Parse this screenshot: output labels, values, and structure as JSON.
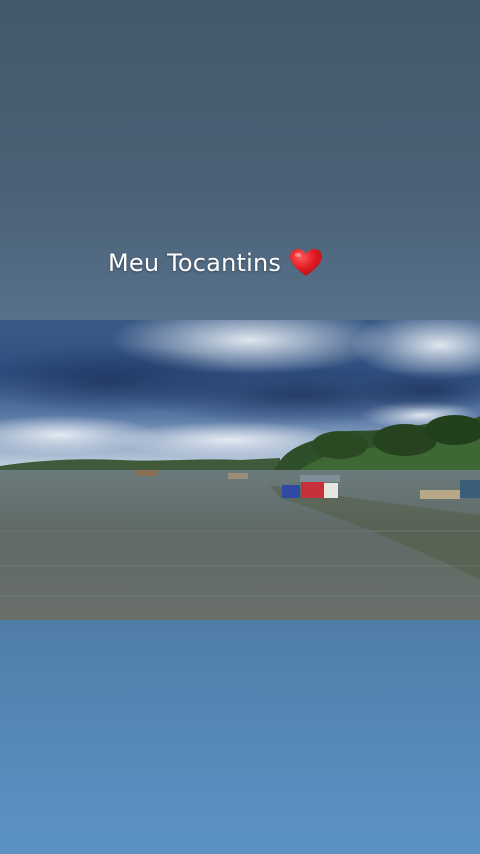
{
  "story": {
    "caption_text": "Meu Tocantins",
    "caption_emoji": "heart-icon",
    "background_top_color": "#44586a",
    "background_bottom_color": "#5b90c2",
    "heart_color": "#e31b23"
  },
  "photo": {
    "subject": "river-landscape-photo"
  }
}
